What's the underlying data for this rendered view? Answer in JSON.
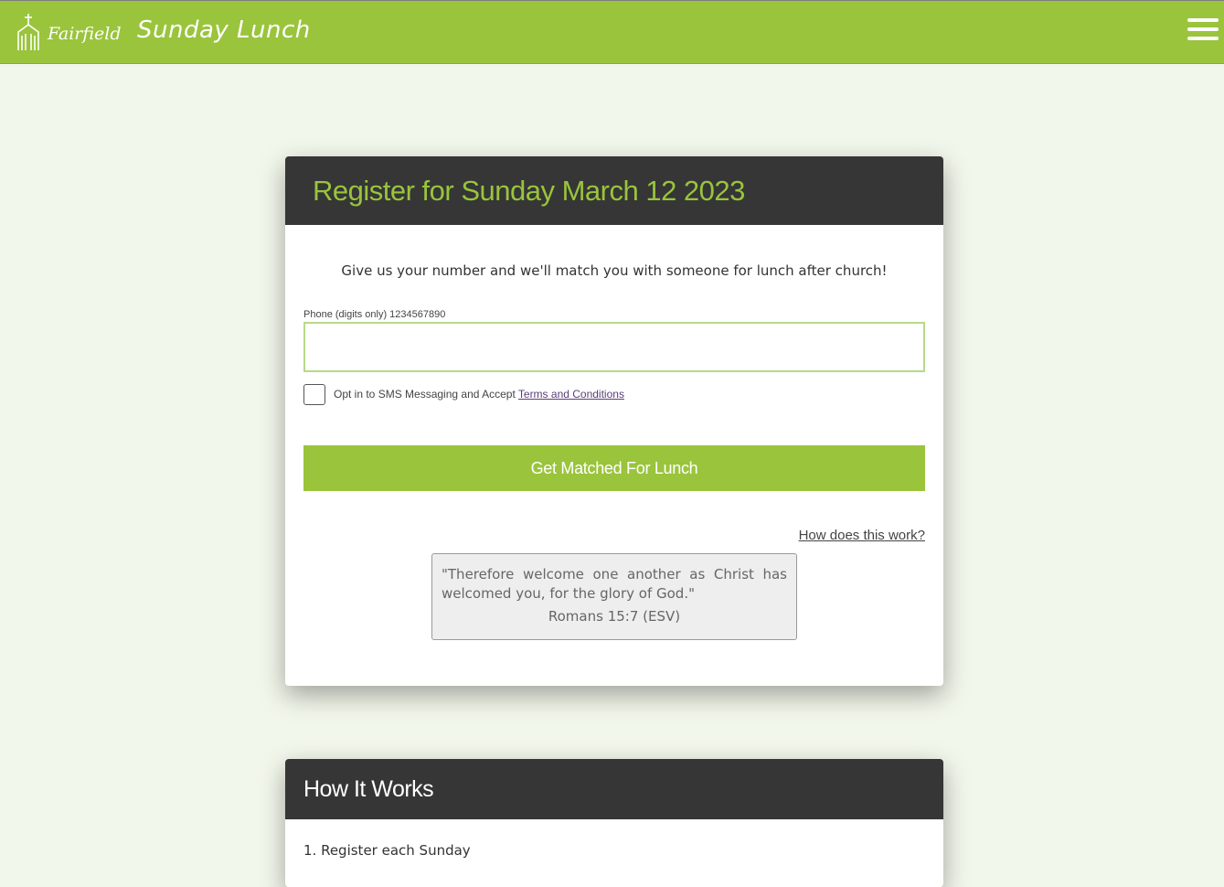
{
  "header": {
    "logo_text": "Fairfield",
    "title": "Sunday Lunch",
    "menu_icon": "hamburger-menu-icon"
  },
  "register_card": {
    "title": "Register for Sunday March 12 2023",
    "intro": "Give us your number and we'll match you with someone for lunch after church!",
    "phone_label": "Phone (digits only) 1234567890",
    "phone_value": "",
    "optin_text": "Opt in to SMS Messaging and Accept ",
    "terms_link": "Terms and Conditions",
    "submit_label": "Get Matched For Lunch",
    "how_link": "How does this work?",
    "verse_text": "\"Therefore welcome one another as Christ has welcomed you, for the glory of God.\"",
    "verse_ref": "Romans 15:7 (ESV)"
  },
  "how_card": {
    "title": "How It Works",
    "step1": "1. Register each Sunday"
  },
  "colors": {
    "brand_green": "#9ac43c",
    "dark_header": "#363636",
    "page_background": "#f2f7eb"
  }
}
